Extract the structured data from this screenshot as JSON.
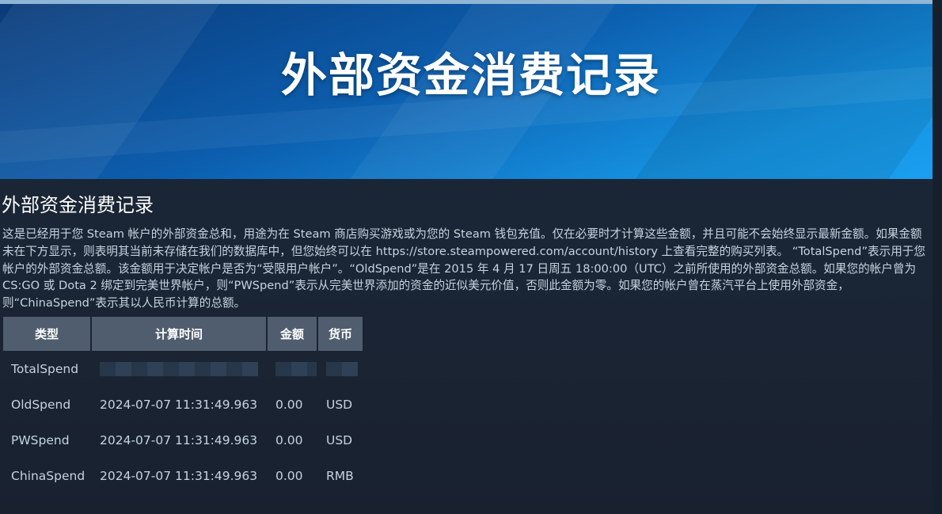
{
  "banner": {
    "title": "外部资金消费记录"
  },
  "page": {
    "heading": "外部资金消费记录",
    "description": "这是已经用于您 Steam 帐户的外部资金总和，用途为在 Steam 商店购买游戏或为您的 Steam 钱包充值。仅在必要时才计算这些金额，并且可能不会始终显示最新金额。如果金额未在下方显示，则表明其当前未存储在我们的数据库中，但您始终可以在 https://store.steampowered.com/account/history 上查看完整的购买列表。 “TotalSpend”表示用于您帐户的外部资金总额。该金额用于决定帐户是否为“受限用户帐户”。“OldSpend”是在 2015 年 4 月 17 日周五 18:00:00（UTC）之前所使用的外部资金总额。如果您的帐户曾为 CS:GO 或 Dota 2 绑定到完美世界帐户，则“PWSpend”表示从完美世界添加的资金的近似美元价值，否则此金额为零。如果您的帐户曾在蒸汽平台上使用外部资金，则“ChinaSpend”表示其以人民币计算的总额。"
  },
  "table": {
    "headers": [
      "类型",
      "计算时间",
      "金额",
      "货币"
    ],
    "rows": [
      {
        "type": "TotalSpend",
        "time": "",
        "amount": "",
        "currency": ""
      },
      {
        "type": "OldSpend",
        "time": "2024-07-07 11:31:49.963",
        "amount": "0.00",
        "currency": "USD"
      },
      {
        "type": "PWSpend",
        "time": "2024-07-07 11:31:49.963",
        "amount": "0.00",
        "currency": "USD"
      },
      {
        "type": "ChinaSpend",
        "time": "2024-07-07 11:31:49.963",
        "amount": "0.00",
        "currency": "RMB"
      }
    ]
  }
}
